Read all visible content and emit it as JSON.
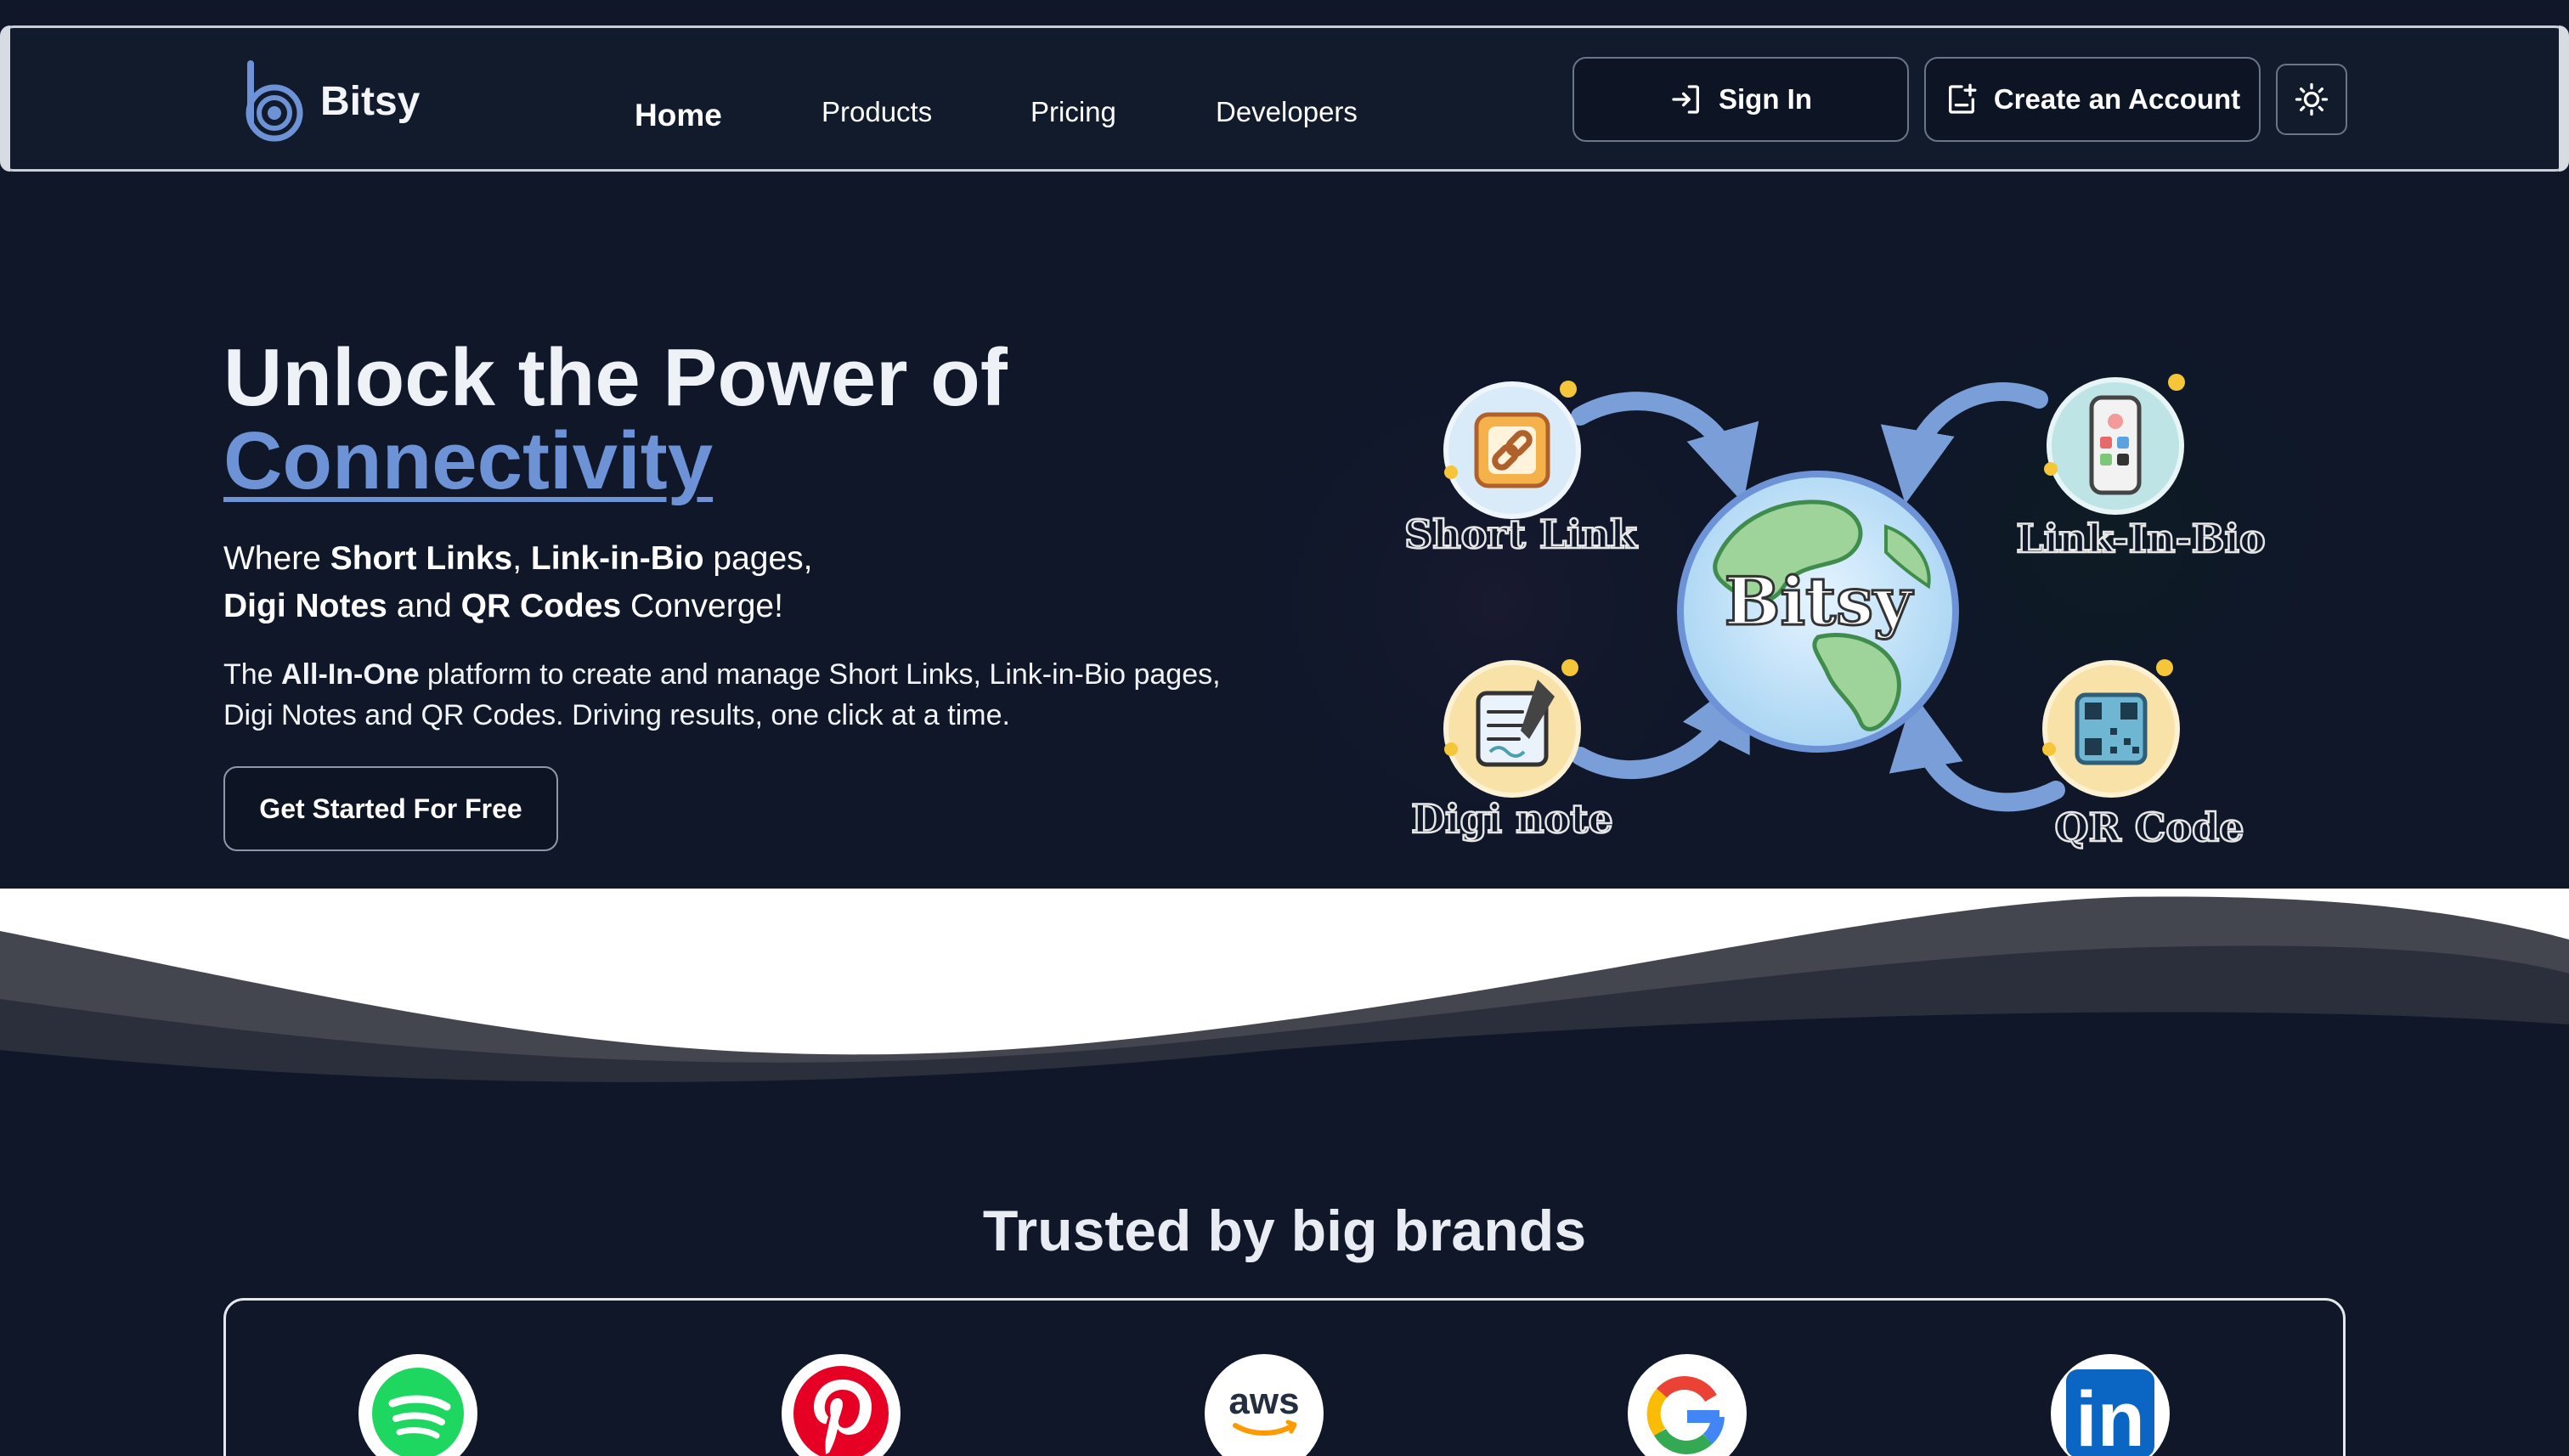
{
  "header": {
    "brand": "Bitsy",
    "nav": [
      {
        "label": "Home",
        "active": true
      },
      {
        "label": "Products",
        "active": false
      },
      {
        "label": "Pricing",
        "active": false
      },
      {
        "label": "Developers",
        "active": false
      }
    ],
    "sign_in_label": "Sign In",
    "create_account_label": "Create an Account",
    "theme_toggle_icon": "sun-icon"
  },
  "hero": {
    "title_line1": "Unlock the Power of",
    "title_accent": "Connectivity",
    "sub": {
      "p1": "Where ",
      "b1": "Short Links",
      "p2": ", ",
      "b2": "Link-in-Bio",
      "p3": " pages,",
      "b3": "Digi Notes",
      "p4": " and ",
      "b4": "QR Codes",
      "p5": " Converge!"
    },
    "desc": {
      "p1": "The ",
      "b1": "All-In-One",
      "p2": " platform to create and manage Short Links, Link-in-Bio pages, Digi Notes and QR Codes. Driving results, one click at a time."
    },
    "cta_label": "Get Started For Free",
    "illustration": {
      "center_label": "Bitsy",
      "nodes": [
        "Short Link",
        "Link-In-Bio",
        "Digi note",
        "QR Code"
      ]
    }
  },
  "brands": {
    "title": "Trusted by big brands",
    "logos": [
      "spotify-logo",
      "pinterest-logo",
      "aws-logo",
      "google-logo",
      "linkedin-logo"
    ],
    "aws_text": "aws",
    "linkedin_text": "in"
  },
  "colors": {
    "background": "#0f1729",
    "accent": "#6d93d6",
    "header_bg": "#111b2c"
  }
}
